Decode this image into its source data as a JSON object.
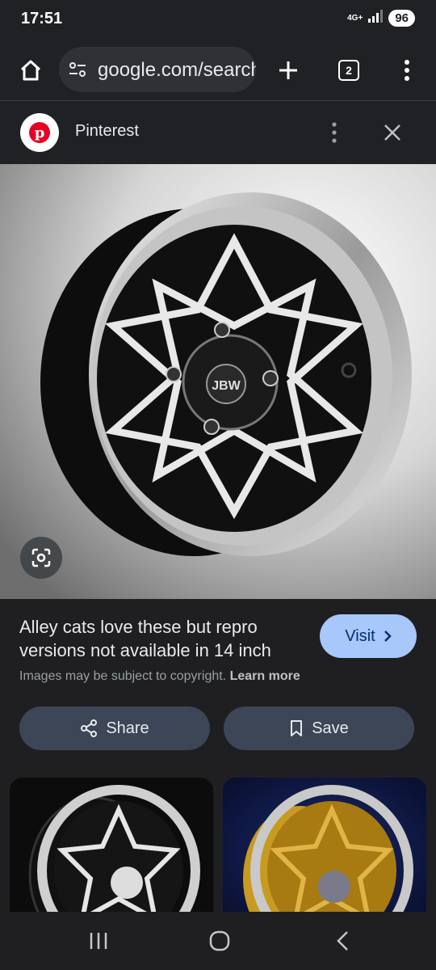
{
  "status": {
    "time": "17:51",
    "network": "4G+",
    "battery": "96"
  },
  "toolbar": {
    "url": "google.com/search",
    "tab_count": "2"
  },
  "source": {
    "name": "Pinterest",
    "logo_letter": "p",
    "brand_color": "#e60023"
  },
  "result": {
    "title": "Alley cats love these but repro versions not available in 14 inch",
    "visit_label": "Visit",
    "copyright_text": "Images may be subject to copyright.",
    "learn_more": "Learn more",
    "share_label": "Share",
    "save_label": "Save",
    "hub_badge": "JBW"
  },
  "colors": {
    "accent": "#a8c7fa",
    "button_bg": "#3c4657",
    "background": "#1f1f21"
  }
}
